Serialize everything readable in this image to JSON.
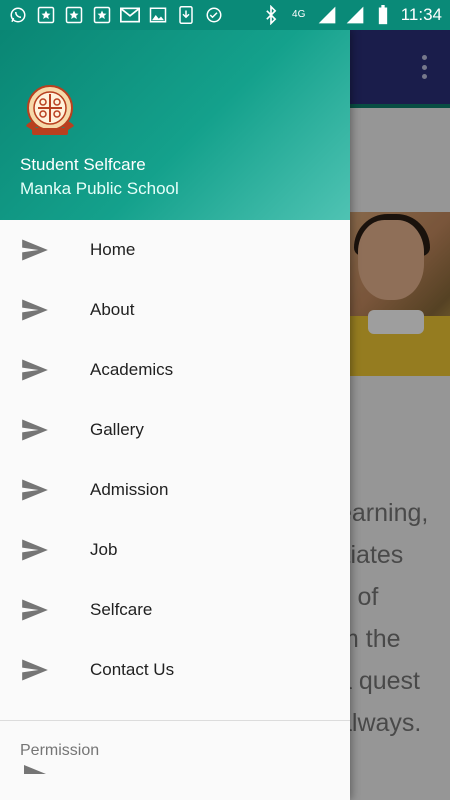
{
  "status_bar": {
    "time": "11:34",
    "network": "4G",
    "icons": [
      "whatsapp-icon",
      "star-box-icon",
      "star-box-icon",
      "star-box-icon",
      "gmail-icon",
      "image-icon",
      "download-icon",
      "check-circle-icon",
      "bluetooth-icon",
      "signal-icon",
      "signal-icon",
      "battery-icon"
    ]
  },
  "drawer": {
    "header": {
      "title": "Student Selfcare",
      "subtitle": "Manka Public School"
    },
    "menu_items": [
      {
        "label": "Home",
        "icon": "send-icon"
      },
      {
        "label": "About",
        "icon": "send-icon"
      },
      {
        "label": "Academics",
        "icon": "send-icon"
      },
      {
        "label": "Gallery",
        "icon": "send-icon"
      },
      {
        "label": "Admission",
        "icon": "send-icon"
      },
      {
        "label": "Job",
        "icon": "send-icon"
      },
      {
        "label": "Selfcare",
        "icon": "send-icon"
      },
      {
        "label": "Contact Us",
        "icon": "send-icon"
      }
    ],
    "section_title": "Permission"
  },
  "background": {
    "text_lines": [
      "earning,",
      "itiates",
      "s of",
      "m the",
      "a quest",
      "always."
    ]
  },
  "colors": {
    "status_bar": "#0a8a78",
    "drawer_header_start": "#0a8674",
    "drawer_header_end": "#4fc3b3",
    "toolbar": "#2b2f79",
    "menu_icon": "#757575"
  }
}
